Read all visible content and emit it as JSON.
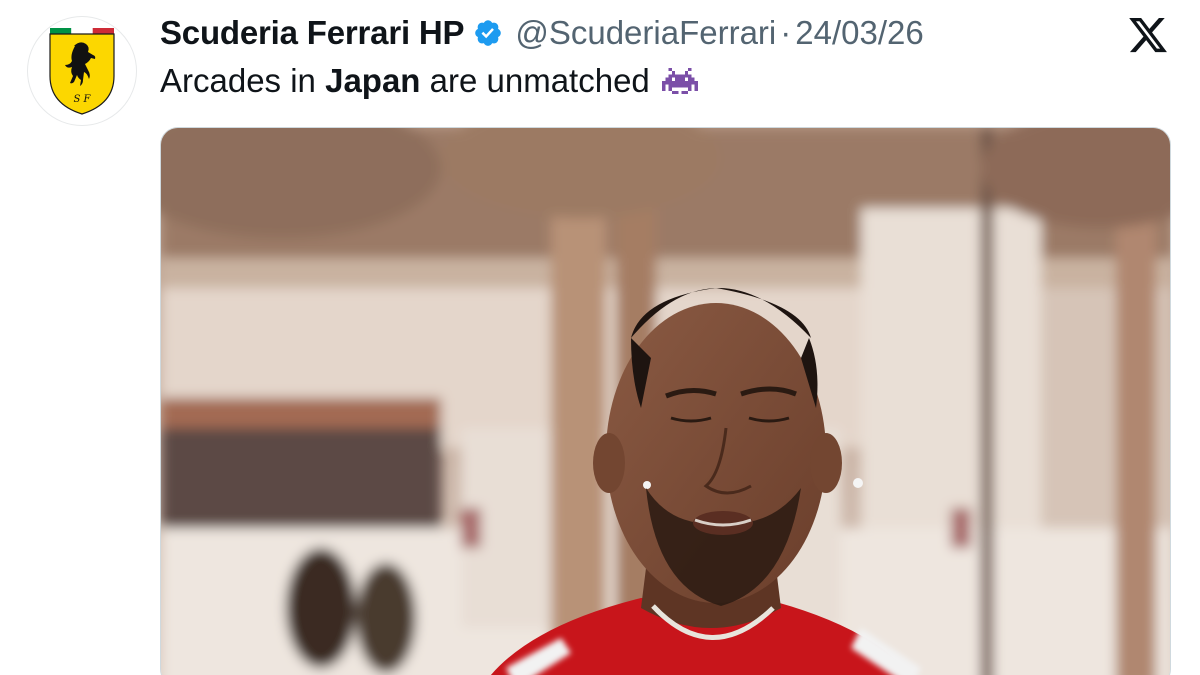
{
  "account": {
    "display_name": "Scuderia Ferrari HP",
    "handle": "@ScuderiaFerrari",
    "separator": "·",
    "date": "24/03/26",
    "verified": true,
    "avatar_icon": "ferrari-prancing-horse-shield-icon",
    "avatar_monogram": "S F"
  },
  "tweet": {
    "text_before": "Arcades in",
    "text_bold": "Japan",
    "text_after": "are unmatched",
    "emoji_icon": "alien-monster-icon"
  },
  "platform": {
    "logo_icon": "x-logo-icon"
  },
  "media": {
    "type": "video-frame",
    "description_icon": "video-still-icon"
  },
  "colors": {
    "text_primary": "#0f1419",
    "text_secondary": "#536471",
    "verified_blue": "#1d9bf0",
    "ferrari_yellow": "#fcd700",
    "ferrari_red": "#d40000",
    "emoji_purple": "#7b4fa8"
  }
}
